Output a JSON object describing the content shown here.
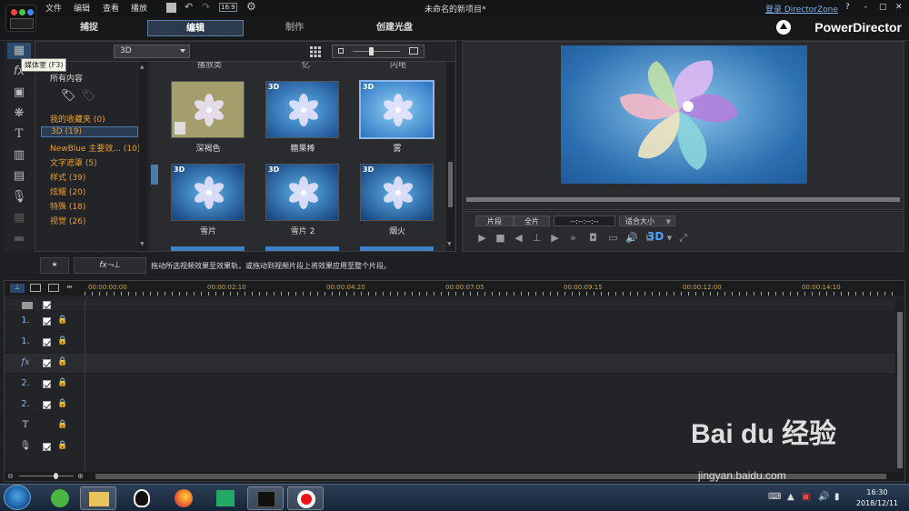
{
  "app": {
    "title": "未命名的新项目*",
    "brand": "PowerDirector",
    "login": "登录 DirectorZone"
  },
  "menu": [
    "文件",
    "编辑",
    "查看",
    "播放"
  ],
  "toolbar": {
    "res": "16:9"
  },
  "window_controls": {
    "help": "?",
    "minimize": "–",
    "maximize": "□",
    "close": "✕"
  },
  "modes": [
    {
      "label": "捕捉"
    },
    {
      "label": "编辑"
    },
    {
      "label": "制作"
    },
    {
      "label": "创建光盘"
    }
  ],
  "tooltip": "媒体室 (F3)",
  "library": {
    "dropdown": "3D",
    "all_content": "所有内容",
    "categories": [
      {
        "label": "我的收藏夹 (0)"
      },
      {
        "label": "3D (19)"
      },
      {
        "label": "NewBlue 主要效... (10)"
      },
      {
        "label": "文字遮罩 (5)"
      },
      {
        "label": "样式 (39)"
      },
      {
        "label": "炫耀 (20)"
      },
      {
        "label": "特殊 (18)"
      },
      {
        "label": "视觉 (26)"
      }
    ],
    "partial_top_labels": [
      "播放类",
      "忆",
      "闪电"
    ],
    "thumb_tag": "3D",
    "thumbs": [
      {
        "label": "深褐色"
      },
      {
        "label": "糖果棒"
      },
      {
        "label": "雾"
      },
      {
        "label": "雪片"
      },
      {
        "label": "雪片 2"
      },
      {
        "label": "烟火"
      }
    ]
  },
  "fx_bar": {
    "hint": "拖动所选视频效果至效果轨，或拖动到视频片段上将效果应用至整个片段。"
  },
  "player": {
    "clip": "片段",
    "full": "全片",
    "timecode": "--:--:--:--",
    "fit": "适合大小",
    "stereo": "3D"
  },
  "timeline": {
    "timecodes": [
      "00:00:00:00",
      "00:00:02:10",
      "00:00:04:20",
      "00:00:07:05",
      "00:00:09:15",
      "00:00:12:00",
      "00:00:14:10"
    ],
    "tracks": [
      {
        "label": "1."
      },
      {
        "label": "1."
      },
      {
        "label": "fx"
      },
      {
        "label": "2."
      },
      {
        "label": "2."
      },
      {
        "label": "T"
      },
      {
        "label": ""
      }
    ]
  },
  "taskbar": {
    "time": "16:30",
    "date": "2018/12/11"
  },
  "watermark": {
    "text": "Bai du 经验",
    "url": "jingyan.baidu.com"
  }
}
